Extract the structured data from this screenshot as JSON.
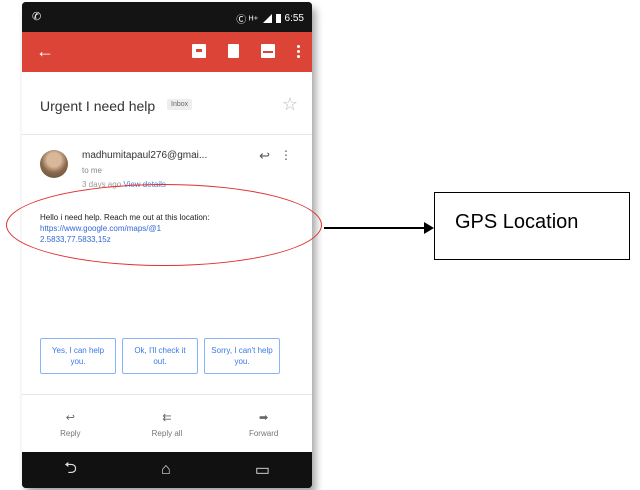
{
  "status_bar": {
    "left_icon": "whatsapp-icon",
    "indicators": "Ⓒ ᴴ⁺",
    "time": "6:55"
  },
  "app_bar": {
    "back_icon": "arrow-left-icon",
    "actions": [
      "archive-icon",
      "trash-icon",
      "mail-icon",
      "more-vert-icon"
    ]
  },
  "email": {
    "subject": "Urgent I need help",
    "label": "Inbox",
    "sender": "madhumitapaul276@gmai...",
    "recipient": "to me",
    "time_ago": "3 days ago",
    "view_details": "View details",
    "body": "Hello i need help. Reach me out at this location:",
    "link_line1": "https://www.google.com/maps/@1",
    "link_line2": "2.5833,77.5833,15z"
  },
  "smart_replies": [
    "Yes, I can help you.",
    "Ok, I'll check it out.",
    "Sorry, I can't help you."
  ],
  "actions": [
    {
      "label": "Reply",
      "icon": "reply-icon"
    },
    {
      "label": "Reply all",
      "icon": "reply-all-icon"
    },
    {
      "label": "Forward",
      "icon": "forward-icon"
    }
  ],
  "nav": [
    "back-icon",
    "home-icon",
    "recents-icon"
  ],
  "annotation": {
    "callout_text": "GPS Location"
  },
  "colors": {
    "app_bar": "#db4437",
    "link": "#3367d6",
    "annotation_ellipse": "#e03030"
  }
}
